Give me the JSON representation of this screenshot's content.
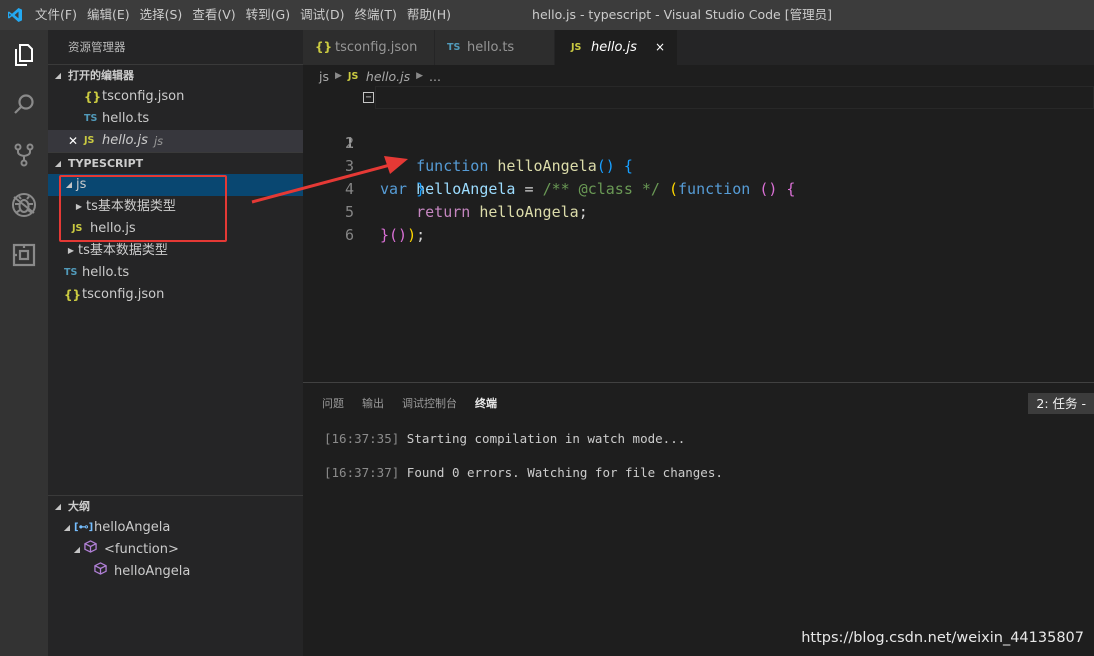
{
  "titlebar": {
    "menu": [
      "文件(F)",
      "编辑(E)",
      "选择(S)",
      "查看(V)",
      "转到(G)",
      "调试(D)",
      "终端(T)",
      "帮助(H)"
    ],
    "window_title": "hello.js - typescript - Visual Studio Code [管理员]"
  },
  "activitybar": {
    "items": [
      "explorer-icon",
      "search-icon",
      "source-control-icon",
      "debug-icon",
      "extensions-icon"
    ]
  },
  "sidebar": {
    "title": "资源管理器",
    "open_editors": {
      "header": "打开的编辑器",
      "items": [
        {
          "icon": "{}",
          "label": "tsconfig.json"
        },
        {
          "icon": "TS",
          "label": "hello.ts"
        },
        {
          "icon": "JS",
          "label": "hello.js",
          "description": "js"
        }
      ]
    },
    "workspace": {
      "header": "TYPESCRIPT",
      "items": [
        {
          "label": "js"
        },
        {
          "label": "ts基本数据类型"
        },
        {
          "icon": "JS",
          "label": "hello.js"
        },
        {
          "label": "ts基本数据类型"
        },
        {
          "icon": "TS",
          "label": "hello.ts"
        },
        {
          "icon": "{}",
          "label": "tsconfig.json"
        }
      ]
    },
    "outline": {
      "header": "大纲",
      "items": [
        {
          "label": "helloAngela"
        },
        {
          "label": "<function>"
        },
        {
          "label": "helloAngela"
        }
      ]
    }
  },
  "editor": {
    "tabs": [
      {
        "icon": "{}",
        "label": "tsconfig.json"
      },
      {
        "icon": "TS",
        "label": "hello.ts"
      },
      {
        "icon": "JS",
        "label": "hello.js",
        "close": "×"
      }
    ],
    "breadcrumb": [
      "js",
      "hello.js",
      "..."
    ],
    "lines": [
      "1",
      "2",
      "3",
      "4",
      "5",
      "6"
    ],
    "code": {
      "l1_kw": "var",
      "l1_name": "helloAngela",
      "l1_eq": " = ",
      "l1_comment": "/** @class */",
      "l1_open": "(",
      "l1_fn": "function",
      "l1_parens": "()",
      "l1_brace": "{",
      "l2_fn": "function",
      "l2_name": "helloAngela",
      "l2_parens": "()",
      "l2_brace": "{",
      "l3_brace": "}",
      "l4_kw": "return",
      "l4_name": "helloAngela",
      "l4_semi": ";",
      "l5_brace": "}",
      "l5_call": "()",
      "l5_close": ")",
      "l5_semi": ";"
    }
  },
  "panel": {
    "tabs": [
      "问题",
      "输出",
      "调试控制台",
      "终端"
    ],
    "terminal_select": "2: 任务 -",
    "terminal_lines": [
      {
        "time": "[16:37:35]",
        "text": " Starting compilation in watch mode..."
      },
      {
        "time": "[16:37:37]",
        "text": " Found 0 errors. Watching for file changes."
      }
    ]
  },
  "watermark": "https://blog.csdn.net/weixin_44135807",
  "colors": {
    "annotation": "#e53935",
    "selection": "#094771"
  }
}
